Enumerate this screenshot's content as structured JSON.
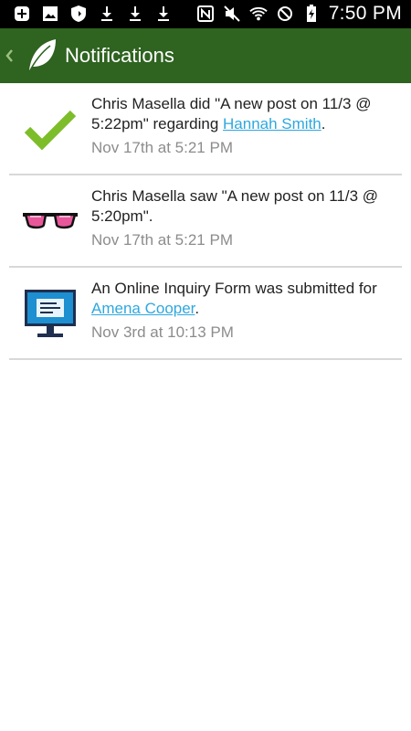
{
  "status_bar": {
    "time": "7:50 PM",
    "left_icons": [
      "plus-icon",
      "image-icon",
      "shield-icon",
      "download-icon",
      "download-icon",
      "download-icon"
    ],
    "right_icons": [
      "nfc-icon",
      "mute-icon",
      "wifi-icon",
      "block-icon",
      "battery-icon"
    ]
  },
  "app_bar": {
    "title": "Notifications",
    "color": "#2e6320"
  },
  "notifications": [
    {
      "icon": "check-icon",
      "prefix": "Chris Masella did \"A new post on 11/3 @ 5:22pm\" regarding ",
      "link": "Hannah Smith",
      "suffix": ".",
      "time": "Nov 17th at 5:21 PM"
    },
    {
      "icon": "glasses-icon",
      "prefix": "Chris Masella saw \"A new post on 11/3 @ 5:20pm\".",
      "link": "",
      "suffix": "",
      "time": "Nov 17th at 5:21 PM"
    },
    {
      "icon": "monitor-icon",
      "prefix": "An Online Inquiry Form was submitted for ",
      "link": "Amena Cooper",
      "suffix": ".",
      "time": "Nov 3rd at 10:13 PM"
    }
  ],
  "colors": {
    "link": "#2ea8df",
    "timestamp": "#8c8c8c",
    "check": "#7dbd2a",
    "glasses_lens": "#e8579a"
  }
}
